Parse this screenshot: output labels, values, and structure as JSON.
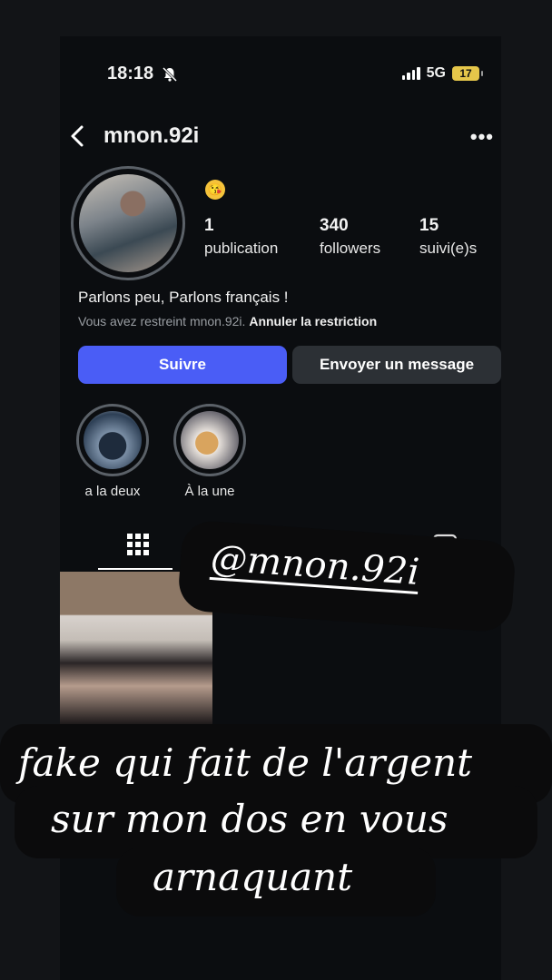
{
  "status": {
    "time": "18:18",
    "network": "5G",
    "battery": "17"
  },
  "header": {
    "username": "mnon.92i",
    "more": "•••"
  },
  "profile": {
    "emoji": "😘",
    "stats": [
      {
        "num": "1",
        "label": "publication"
      },
      {
        "num": "340",
        "label": "followers"
      },
      {
        "num": "15",
        "label": "suivi(e)s"
      }
    ],
    "bio": "Parlons peu, Parlons français !",
    "restrict_text": "Vous avez restreint mnon.92i.",
    "restrict_action": "Annuler la restriction"
  },
  "buttons": {
    "follow": "Suivre",
    "message": "Envoyer un message"
  },
  "highlights": [
    {
      "label": "a la deux"
    },
    {
      "label": "À la une"
    }
  ],
  "overlay": {
    "tag": "@mnon.92i",
    "caption": [
      "fake qui fait de l'argent",
      "sur mon dos en vous",
      "arnaquant"
    ]
  },
  "icons": [
    "bell-slash-icon",
    "signal-icon",
    "battery-icon",
    "back-icon",
    "more-icon",
    "grid-icon",
    "reels-icon",
    "tagged-icon"
  ],
  "colors": {
    "follow_button": "#4a5df6",
    "message_button": "#2c3035",
    "background": "#0b0d10"
  }
}
